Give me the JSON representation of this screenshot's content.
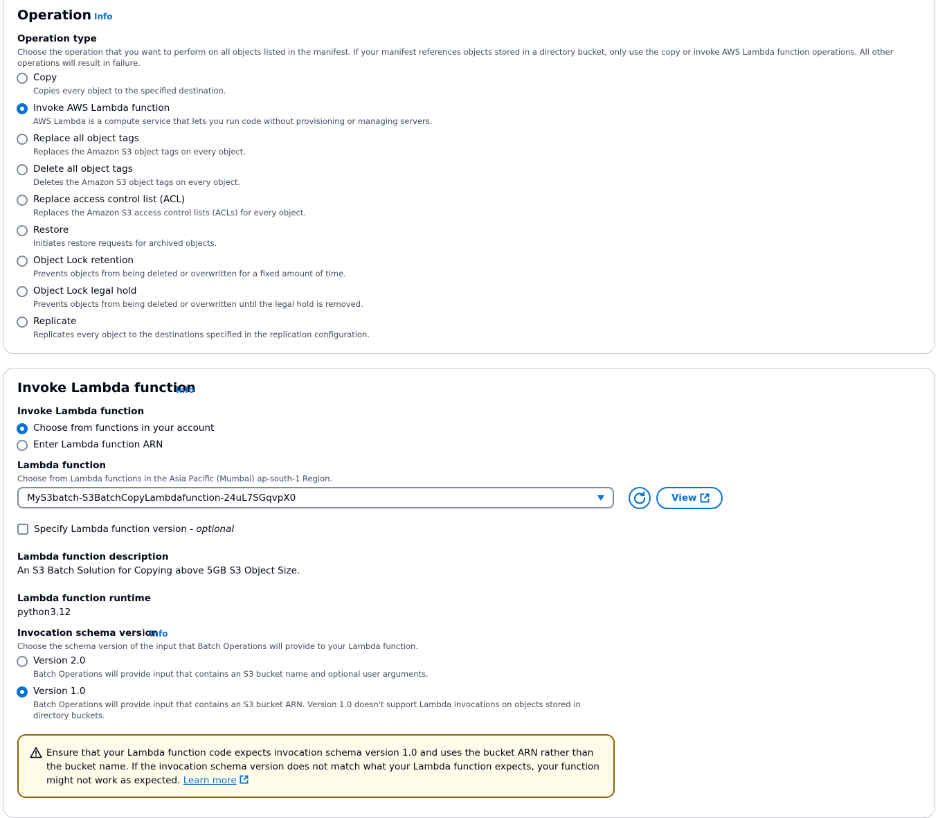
{
  "operation": {
    "title": "Operation",
    "info": "Info",
    "type_label": "Operation type",
    "type_desc": "Choose the operation that you want to perform on all objects listed in the manifest. If your manifest references objects stored in a directory bucket, only use the copy or invoke AWS Lambda function operations. All other operations will result in failure.",
    "options": [
      {
        "label": "Copy",
        "desc": "Copies every object to the specified destination.",
        "selected": false
      },
      {
        "label": "Invoke AWS Lambda function",
        "desc": "AWS Lambda is a compute service that lets you run code without provisioning or managing servers.",
        "selected": true
      },
      {
        "label": "Replace all object tags",
        "desc": "Replaces the Amazon S3 object tags on every object.",
        "selected": false
      },
      {
        "label": "Delete all object tags",
        "desc": "Deletes the Amazon S3 object tags on every object.",
        "selected": false
      },
      {
        "label": "Replace access control list (ACL)",
        "desc": "Replaces the Amazon S3 access control lists (ACLs) for every object.",
        "selected": false
      },
      {
        "label": "Restore",
        "desc": "Initiates restore requests for archived objects.",
        "selected": false
      },
      {
        "label": "Object Lock retention",
        "desc": "Prevents objects from being deleted or overwritten for a fixed amount of time.",
        "selected": false
      },
      {
        "label": "Object Lock legal hold",
        "desc": "Prevents objects from being deleted or overwritten until the legal hold is removed.",
        "selected": false
      },
      {
        "label": "Replicate",
        "desc": "Replicates every object to the destinations specified in the replication configuration.",
        "selected": false
      }
    ]
  },
  "invoke": {
    "title": "Invoke Lambda function",
    "info": "Info",
    "source_label": "Invoke Lambda function",
    "source_options": [
      {
        "label": "Choose from functions in your account",
        "selected": true
      },
      {
        "label": "Enter Lambda function ARN",
        "selected": false
      }
    ],
    "function_label": "Lambda function",
    "function_desc": "Choose from Lambda functions in the Asia Pacific (Mumbai) ap-south-1 Region.",
    "function_value": "MyS3batch-S3BatchCopyLambdafunction-24uL7SGqvpX0",
    "view_label": "View",
    "version_checkbox_label": "Specify Lambda function version - ",
    "version_checkbox_optional": "optional",
    "description_label": "Lambda function description",
    "description_value": "An S3 Batch Solution for Copying above 5GB S3 Object Size.",
    "runtime_label": "Lambda function runtime",
    "runtime_value": "python3.12",
    "schema_label": "Invocation schema version",
    "schema_info": "Info",
    "schema_desc": "Choose the schema version of the input that Batch Operations will provide to your Lambda function.",
    "schema_options": [
      {
        "label": "Version 2.0",
        "desc": "Batch Operations will provide input that contains an S3 bucket name and optional user arguments.",
        "selected": false
      },
      {
        "label": "Version 1.0",
        "desc": "Batch Operations will provide input that contains an S3 bucket ARN. Version 1.0 doesn't support Lambda invocations on objects stored in directory buckets.",
        "selected": true
      }
    ],
    "alert_text": "Ensure that your Lambda function code expects invocation schema version 1.0 and uses the bucket ARN rather than the bucket name. If the invocation schema version does not match what your Lambda function expects, your function might not work as expected. ",
    "alert_link": "Learn more"
  },
  "colors": {
    "accent": "#0972d3",
    "warning_border": "#8d6605",
    "warning_bg": "#fffce9"
  }
}
